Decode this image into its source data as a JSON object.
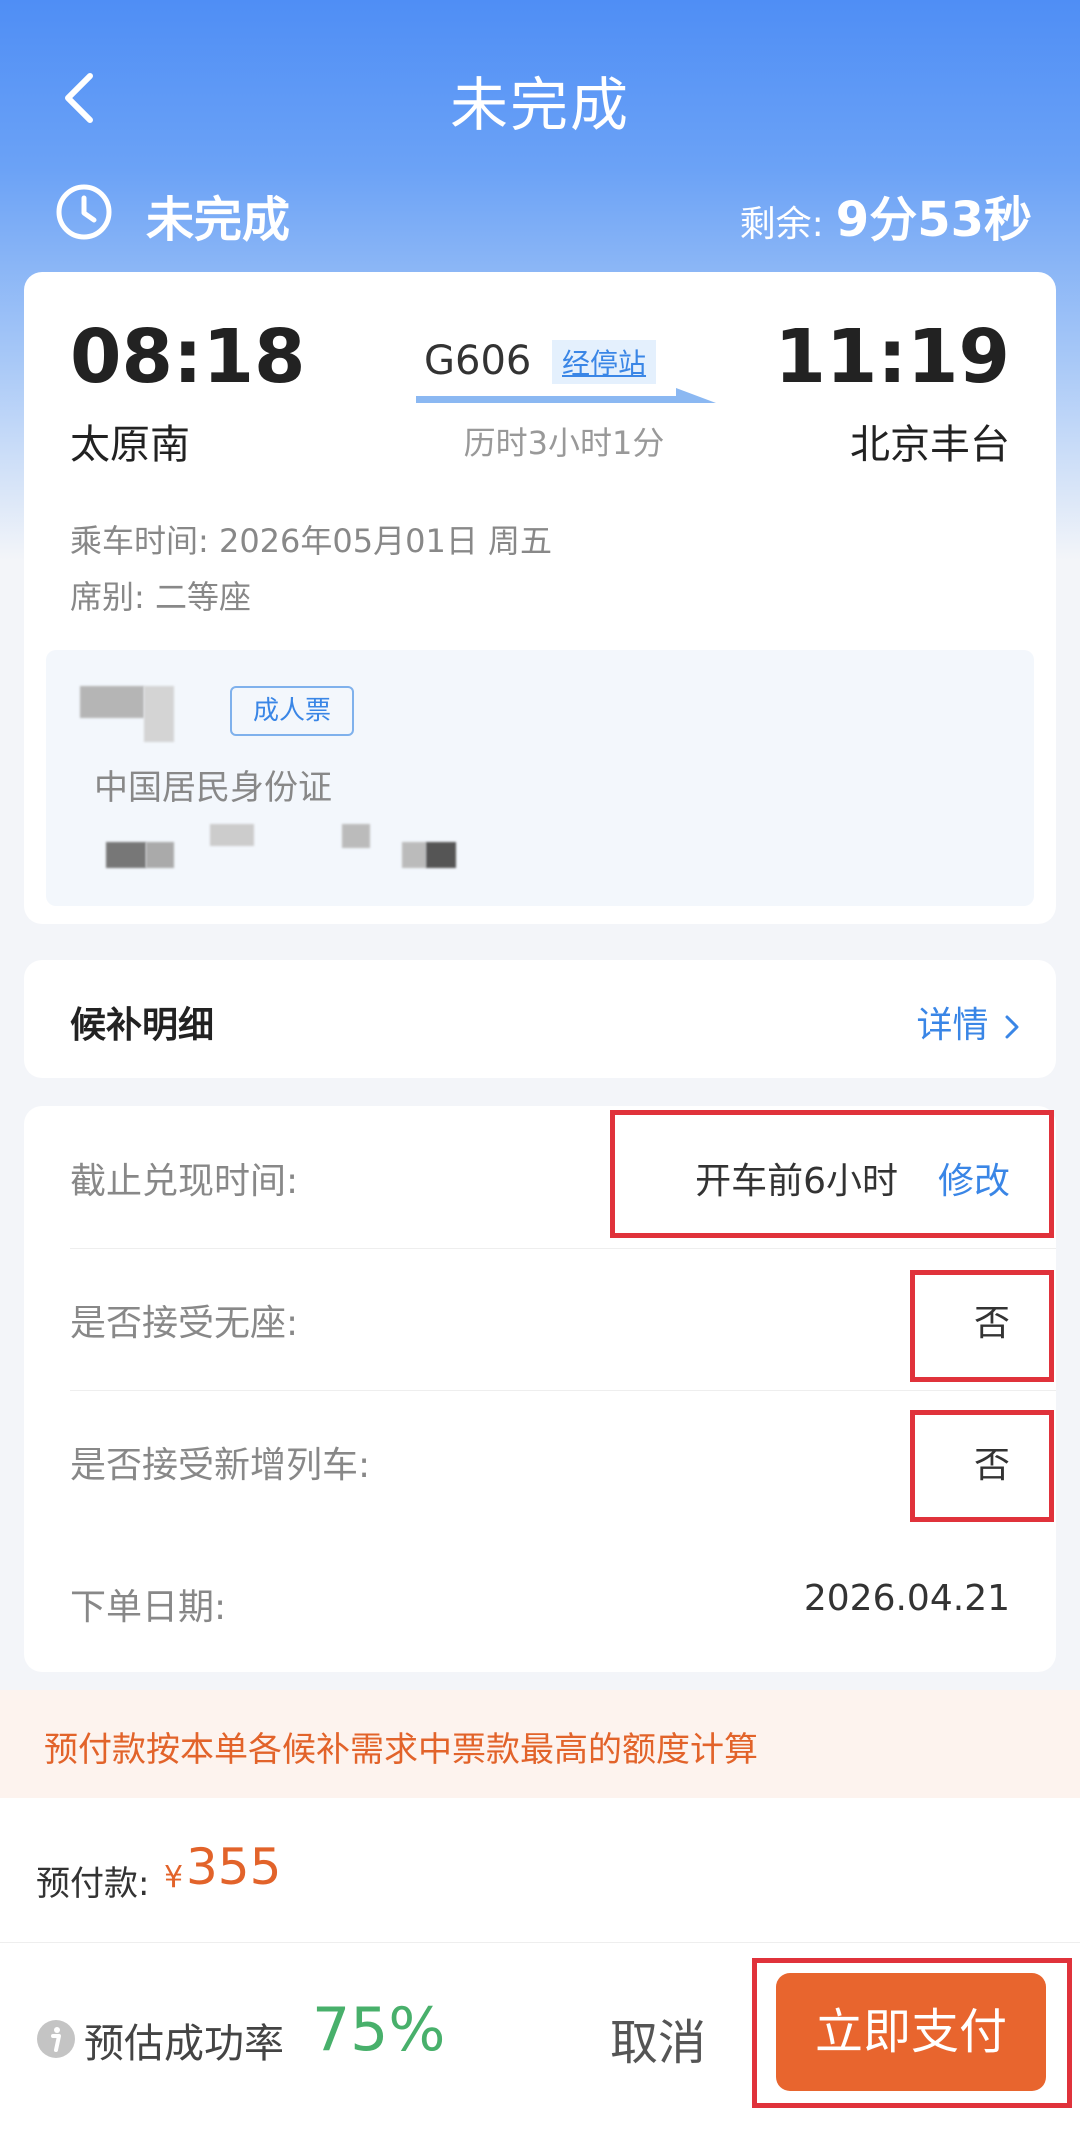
{
  "nav": {
    "title": "未完成"
  },
  "status": {
    "text": "未完成",
    "remaining_label": "剩余:",
    "remaining_value": "9分53秒"
  },
  "ticket": {
    "departure_time": "08:18",
    "departure_station": "太原南",
    "train_number": "G606",
    "stops_link": "经停站",
    "duration": "历时3小时1分",
    "arrival_time": "11:19",
    "arrival_station": "北京丰台",
    "ride_time": "乘车时间: 2026年05月01日 周五",
    "seat_class": "席别: 二等座",
    "passenger": {
      "ticket_type": "成人票",
      "id_type": "中国居民身份证"
    }
  },
  "detail": {
    "title": "候补明细",
    "link": "详情"
  },
  "info": {
    "deadline_label": "截止兑现时间:",
    "deadline_value": "开车前6小时",
    "modify": "修改",
    "no_seat_label": "是否接受无座:",
    "no_seat_value": "否",
    "new_train_label": "是否接受新增列车:",
    "new_train_value": "否",
    "order_date_label": "下单日期:",
    "order_date_value": "2026.04.21"
  },
  "notice": "预付款按本单各候补需求中票款最高的额度计算",
  "prepay": {
    "label": "预付款:",
    "currency": "¥",
    "amount": "355"
  },
  "footer": {
    "rate_label": "预估成功率",
    "rate_value": "75%",
    "cancel": "取消",
    "pay": "立即支付"
  },
  "colors": {
    "brand_blue": "#4f8ef5",
    "link_blue": "#3a86e6",
    "accent_orange": "#e8652e",
    "success_green": "#48b06b",
    "highlight_red": "#e0323b"
  }
}
